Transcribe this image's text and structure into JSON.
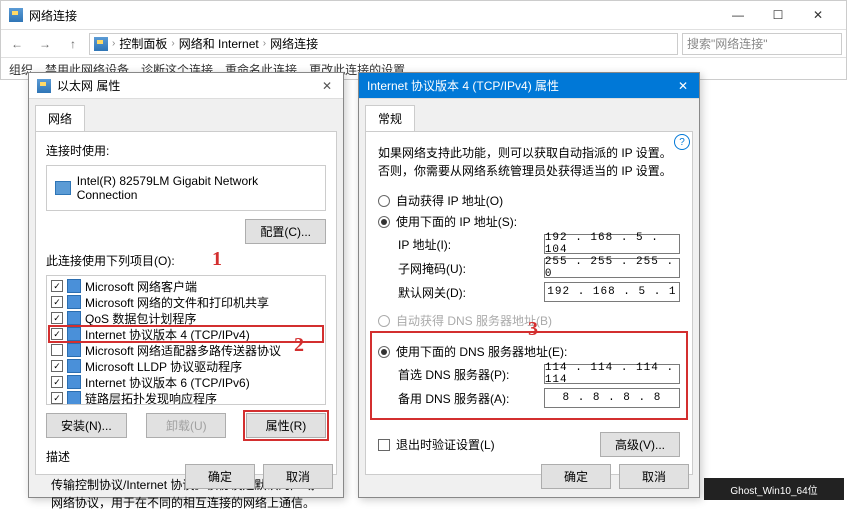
{
  "explorer": {
    "title": "网络连接",
    "breadcrumb": [
      "控制面板",
      "网络和 Internet",
      "网络连接"
    ],
    "search_placeholder": "搜索\"网络连接\"",
    "toolbar": [
      "组织",
      "禁用此网络设备",
      "诊断这个连接",
      "重命名此连接",
      "更改此连接的设置"
    ]
  },
  "ethernet_dialog": {
    "title": "以太网 属性",
    "tab": "网络",
    "connect_using_label": "连接时使用:",
    "adapter": "Intel(R) 82579LM Gigabit Network Connection",
    "configure_btn": "配置(C)...",
    "items_label": "此连接使用下列项目(O):",
    "items": [
      {
        "checked": true,
        "label": "Microsoft 网络客户端"
      },
      {
        "checked": true,
        "label": "Microsoft 网络的文件和打印机共享"
      },
      {
        "checked": true,
        "label": "QoS 数据包计划程序"
      },
      {
        "checked": true,
        "label": "Internet 协议版本 4 (TCP/IPv4)",
        "selected": true
      },
      {
        "checked": false,
        "label": "Microsoft 网络适配器多路传送器协议"
      },
      {
        "checked": true,
        "label": "Microsoft LLDP 协议驱动程序"
      },
      {
        "checked": true,
        "label": "Internet 协议版本 6 (TCP/IPv6)"
      },
      {
        "checked": true,
        "label": "链路层拓扑发现响应程序"
      }
    ],
    "install_btn": "安装(N)...",
    "uninstall_btn": "卸载(U)",
    "properties_btn": "属性(R)",
    "desc_label": "描述",
    "desc_text": "传输控制协议/Internet 协议。该协议是默认的广域网络协议，用于在不同的相互连接的网络上通信。",
    "ok": "确定",
    "cancel": "取消"
  },
  "ipv4_dialog": {
    "title": "Internet 协议版本 4 (TCP/IPv4) 属性",
    "tab": "常规",
    "info": "如果网络支持此功能，则可以获取自动指派的 IP 设置。否则，你需要从网络系统管理员处获得适当的 IP 设置。",
    "radio_auto_ip": "自动获得 IP 地址(O)",
    "radio_manual_ip": "使用下面的 IP 地址(S):",
    "ip_label": "IP 地址(I):",
    "ip_value": "192 . 168 .  5  . 104",
    "mask_label": "子网掩码(U):",
    "mask_value": "255 . 255 . 255 .  0",
    "gw_label": "默认网关(D):",
    "gw_value": "192 . 168 .  5  .  1",
    "radio_auto_dns": "自动获得 DNS 服务器地址(B)",
    "radio_manual_dns": "使用下面的 DNS 服务器地址(E):",
    "dns1_label": "首选 DNS 服务器(P):",
    "dns1_value": "114 . 114 . 114 . 114",
    "dns2_label": "备用 DNS 服务器(A):",
    "dns2_value": "8  .  8  .  8  .  8",
    "validate_label": "退出时验证设置(L)",
    "advanced_btn": "高级(V)...",
    "ok": "确定",
    "cancel": "取消"
  },
  "annotations": {
    "a1": "1",
    "a2": "2",
    "a3": "3"
  },
  "taskbar": "Ghost_Win10_64位"
}
